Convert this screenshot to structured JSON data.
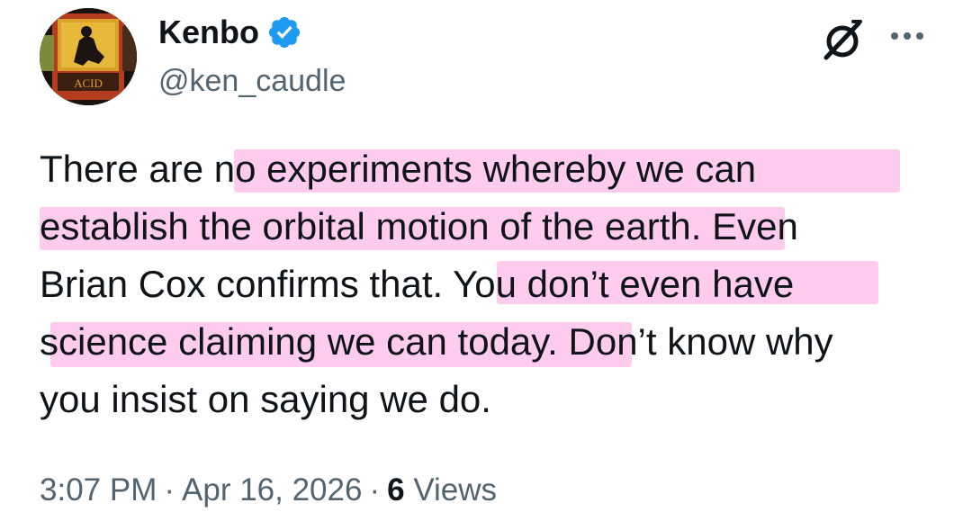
{
  "author": {
    "display_name": "Kenbo",
    "handle": "@ken_caudle",
    "verified": true,
    "avatar_label": "ACID"
  },
  "tweet": {
    "lines": [
      "There are no experiments whereby we can",
      "establish the orbital motion of the earth. Even",
      "Brian Cox confirms that. You don’t even have",
      "science claiming we can today. Don’t know why",
      "you insist on saying we do."
    ]
  },
  "meta": {
    "time": "3:07 PM",
    "separator": "·",
    "date": "Apr 16, 2026",
    "views_count": "6",
    "views_label": "Views"
  },
  "icons": {
    "verified": "verified-badge-icon",
    "grok": "grok-icon",
    "more": "more-icon"
  },
  "colors": {
    "highlight": "#ff78d2",
    "verified_blue": "#1d9bf0",
    "secondary_text": "#536471",
    "primary_text": "#0f1419"
  }
}
